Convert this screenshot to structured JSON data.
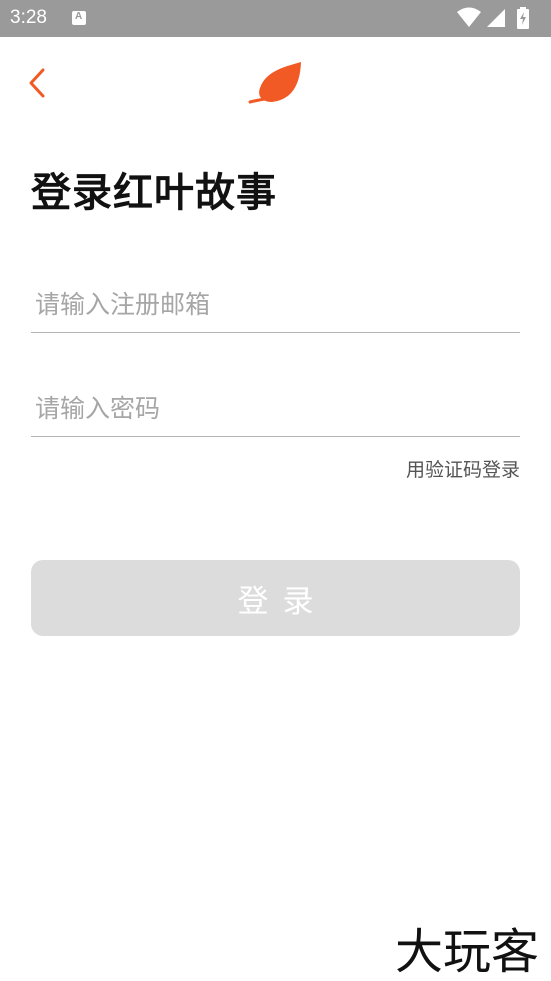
{
  "status_bar": {
    "time": "3:28",
    "notification_glyph": "A",
    "icons": [
      "wifi-icon",
      "cell-signal-icon",
      "battery-charging-icon"
    ]
  },
  "header": {
    "back_icon": "chevron-left-icon",
    "logo_icon": "leaf-icon"
  },
  "login": {
    "title": "登录红叶故事",
    "email_placeholder": "请输入注册邮箱",
    "email_value": "",
    "password_placeholder": "请输入密码",
    "password_value": "",
    "code_login_label": "用验证码登录",
    "submit_label": "登录"
  },
  "watermark": {
    "text": "大玩客"
  },
  "colors": {
    "accent": "#f15a24",
    "status_bar_bg": "#9a9a9a",
    "button_disabled_bg": "#dcdcdc",
    "divider": "#b5b5b5",
    "placeholder": "#a6a6a6"
  }
}
